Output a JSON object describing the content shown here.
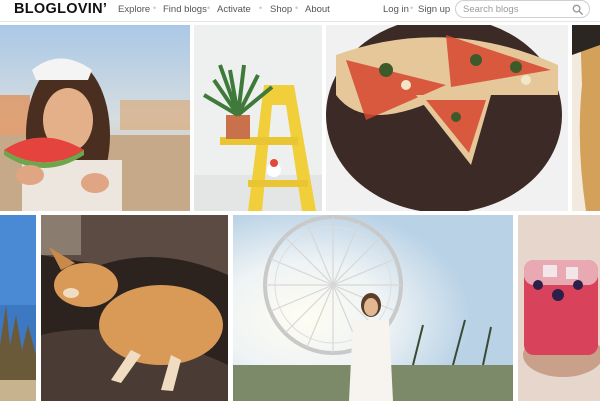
{
  "header": {
    "logo": "BLOGLOVIN’",
    "nav": {
      "explore": "Explore",
      "find_blogs": "Find blogs",
      "activate": "Activate",
      "shop": "Shop",
      "about": "About",
      "login": "Log in",
      "signup": "Sign up"
    },
    "search": {
      "placeholder": "Search blogs",
      "icon": "search-icon"
    }
  },
  "tiles": [
    {
      "name": "tile-watermelon-girl",
      "subject": "woman eating watermelon at festival"
    },
    {
      "name": "tile-plant-ladder",
      "subject": "potted plant on yellow ladder"
    },
    {
      "name": "tile-pizza",
      "subject": "sliced pizza on dark pan"
    },
    {
      "name": "tile-hair-edge",
      "subject": "partial portrait"
    },
    {
      "name": "tile-sky-edge",
      "subject": "blue sky and plants"
    },
    {
      "name": "tile-sleeping-dog",
      "subject": "dog sleeping on couch"
    },
    {
      "name": "tile-ferris-wheel",
      "subject": "woman in front of ferris wheel"
    },
    {
      "name": "tile-red-drink",
      "subject": "red drink with ice and berries"
    }
  ],
  "colors": {
    "accent": "#111111",
    "nav_text": "#555555",
    "background": "#ffffff"
  }
}
